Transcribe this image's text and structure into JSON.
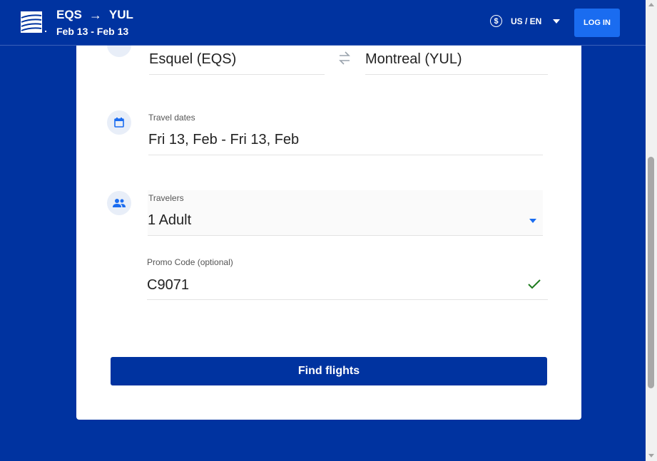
{
  "header": {
    "origin_code": "EQS",
    "destination_code": "YUL",
    "dates": "Feb 13 - Feb 13",
    "currency_label": "US / EN",
    "login_label": "LOG IN"
  },
  "form": {
    "origin_value": "Esquel (EQS)",
    "destination_value": "Montreal (YUL)",
    "travel_dates_label": "Travel dates",
    "travel_dates_value": "Fri 13, Feb - Fri 13, Feb",
    "travelers_label": "Travelers",
    "travelers_value": "1 Adult",
    "promo_label": "Promo Code (optional)",
    "promo_value": "C9071",
    "submit_label": "Find flights"
  },
  "icons": {
    "logo": "airline-logo-icon",
    "route_arrow": "arrow-right-icon",
    "currency": "dollar-circle-icon",
    "currency_dropdown": "chevron-down-icon",
    "location": "location-icon",
    "swap": "swap-icon",
    "calendar": "calendar-icon",
    "travelers": "people-icon",
    "travelers_dropdown": "chevron-down-icon",
    "promo_valid": "checkmark-icon"
  },
  "colors": {
    "brand_blue": "#0033a0",
    "accent_blue": "#1a6cf0",
    "card_background": "#ffffff",
    "valid_green": "#1e7b1e"
  }
}
